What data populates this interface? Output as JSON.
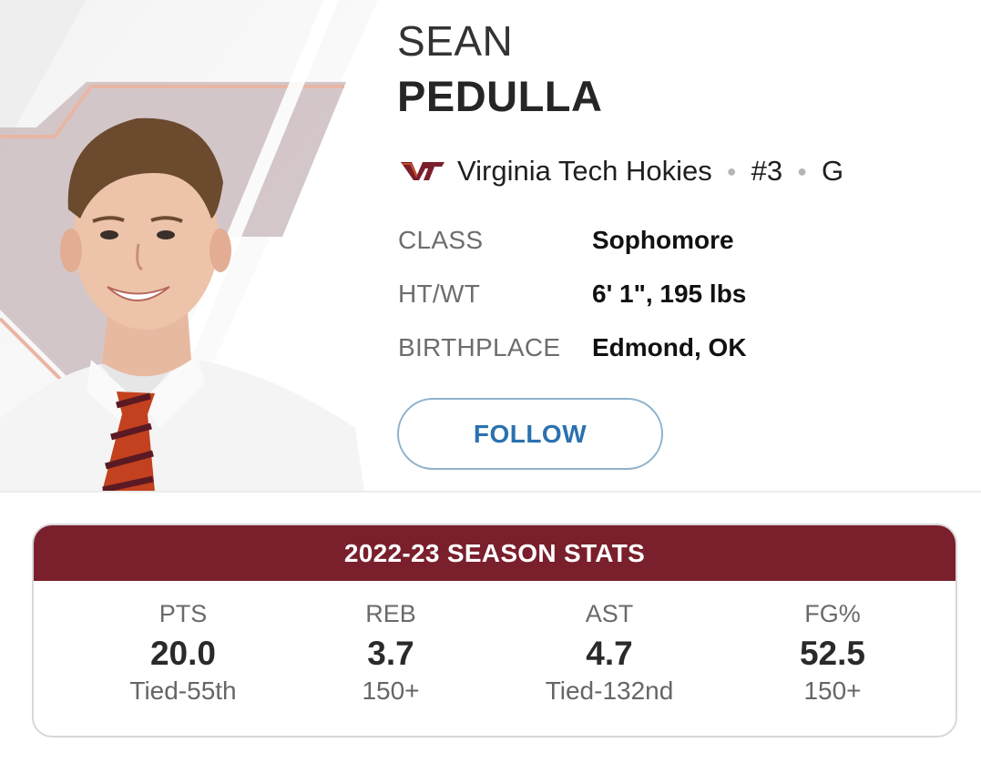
{
  "player": {
    "first_name": "SEAN",
    "last_name": "PEDULLA",
    "team": "Virginia Tech Hokies",
    "team_logo_icon": "vt-logo-icon",
    "number": "#3",
    "position": "G"
  },
  "bio": [
    {
      "label": "CLASS",
      "value": "Sophomore"
    },
    {
      "label": "HT/WT",
      "value": "6' 1\", 195 lbs"
    },
    {
      "label": "BIRTHPLACE",
      "value": "Edmond, OK"
    }
  ],
  "follow_label": "FOLLOW",
  "stats": {
    "title": "2022-23 SEASON STATS",
    "items": [
      {
        "label": "PTS",
        "value": "20.0",
        "rank": "Tied-55th"
      },
      {
        "label": "REB",
        "value": "3.7",
        "rank": "150+"
      },
      {
        "label": "AST",
        "value": "4.7",
        "rank": "Tied-132nd"
      },
      {
        "label": "FG%",
        "value": "52.5",
        "rank": "150+"
      }
    ]
  },
  "colors": {
    "team_maroon": "#7a1f2c",
    "team_orange": "#e5591e",
    "follow_blue": "#2a71b0"
  }
}
